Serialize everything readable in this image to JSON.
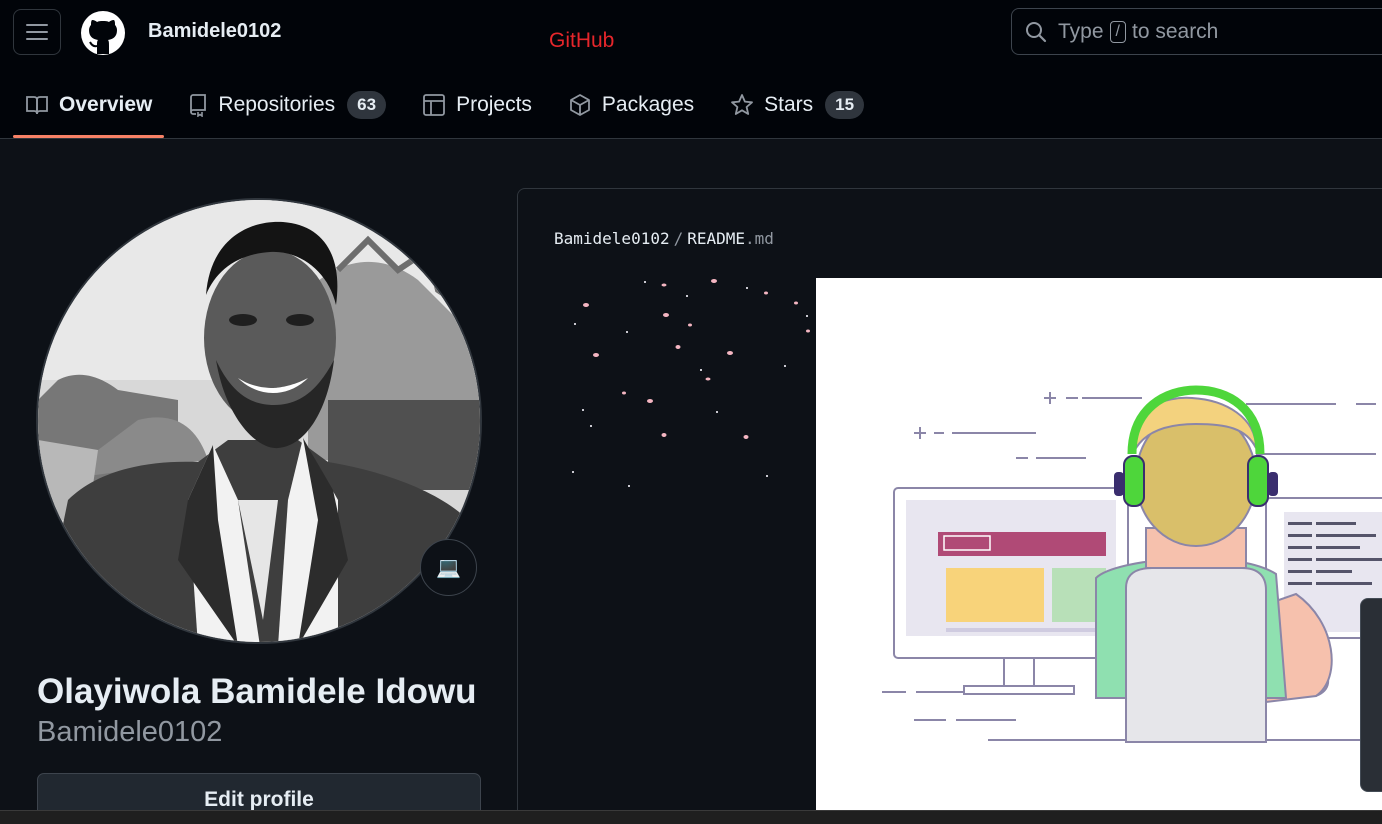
{
  "header": {
    "username": "Bamidele0102",
    "site_label": "GitHub",
    "search": {
      "prefix": "Type",
      "key": "/",
      "suffix": "to search"
    }
  },
  "tabs": [
    {
      "label": "Overview",
      "icon": "book-icon",
      "active": true
    },
    {
      "label": "Repositories",
      "icon": "repo-icon",
      "count": "63"
    },
    {
      "label": "Projects",
      "icon": "table-icon"
    },
    {
      "label": "Packages",
      "icon": "package-icon"
    },
    {
      "label": "Stars",
      "icon": "star-icon",
      "count": "15"
    }
  ],
  "profile": {
    "full_name": "Olayiwola Bamidele Idowu",
    "login": "Bamidele0102",
    "status_emoji": "💻",
    "edit_label": "Edit profile"
  },
  "readme": {
    "owner": "Bamidele0102",
    "separator": "/",
    "file_base": "README",
    "file_ext": ".md"
  },
  "colors": {
    "accent_underline": "#f78166",
    "background": "#0d1117",
    "header_bg": "#010409",
    "site_label": "#e5262b"
  }
}
